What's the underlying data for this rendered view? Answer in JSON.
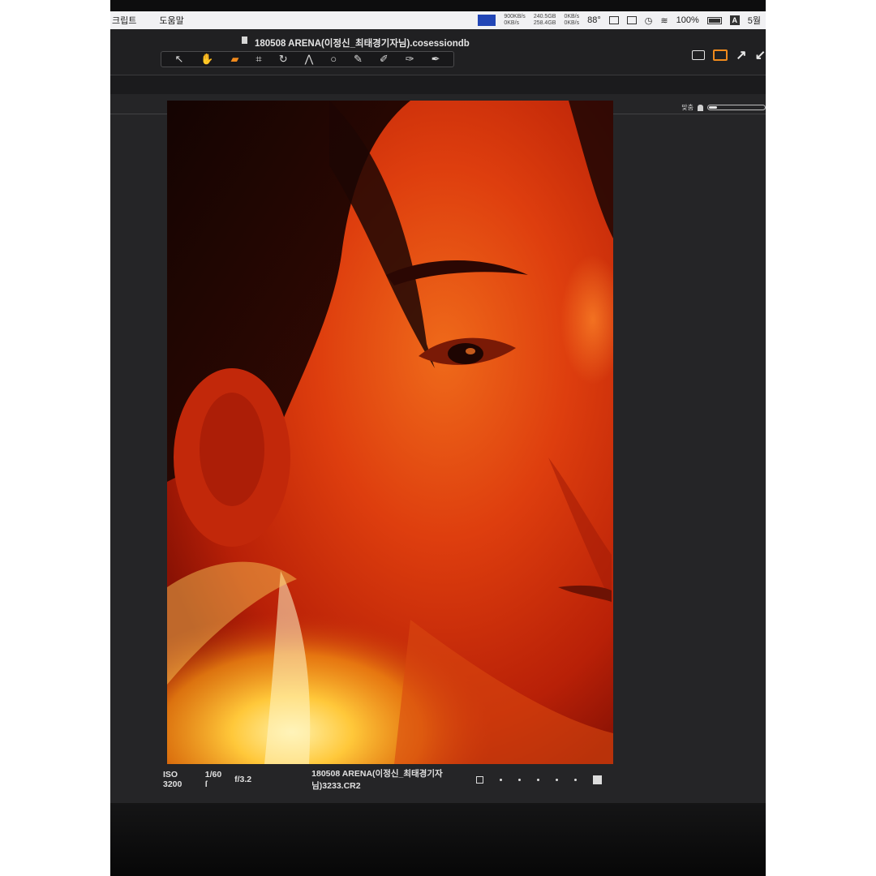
{
  "menubar": {
    "items": [
      "크립트",
      "도움말"
    ],
    "net_up": "900KB/s",
    "net_down": "0KB/s",
    "disk_top": "240.5GB",
    "disk_bottom": "258.4GB",
    "io_top": "0KB/s",
    "io_bottom": "0KB/s",
    "temperature": "88°",
    "battery": "100%",
    "input_source": "A",
    "clock": "5월"
  },
  "window": {
    "title": "180508 ARENA(이정신_최태경기자님).cosessiondb"
  },
  "toolbar": {
    "tools": [
      {
        "name": "select-tool-icon",
        "glyph": "↖"
      },
      {
        "name": "pan-tool-icon",
        "glyph": "✋"
      },
      {
        "name": "loupe-tool-icon",
        "glyph": "▰",
        "active": true
      },
      {
        "name": "crop-tool-icon",
        "glyph": "⌗"
      },
      {
        "name": "rotate-tool-icon",
        "glyph": "↻"
      },
      {
        "name": "keystone-tool-icon",
        "glyph": "⋀"
      },
      {
        "name": "spot-removal-tool-icon",
        "glyph": "○"
      },
      {
        "name": "brush-tool-icon",
        "glyph": "✎"
      },
      {
        "name": "eraser-tool-icon",
        "glyph": "✐"
      },
      {
        "name": "gradient-tool-icon",
        "glyph": "✑"
      },
      {
        "name": "annotation-tool-icon",
        "glyph": "✒"
      }
    ]
  },
  "viewer": {
    "fit_label": "맞춤"
  },
  "status": {
    "iso": "ISO 3200",
    "shutter": "1/60 ſ",
    "aperture": "f/3.2",
    "filename": "180508 ARENA(이정신_최태경기자님)3233.CR2",
    "rating": 0,
    "rating_max": 5
  }
}
